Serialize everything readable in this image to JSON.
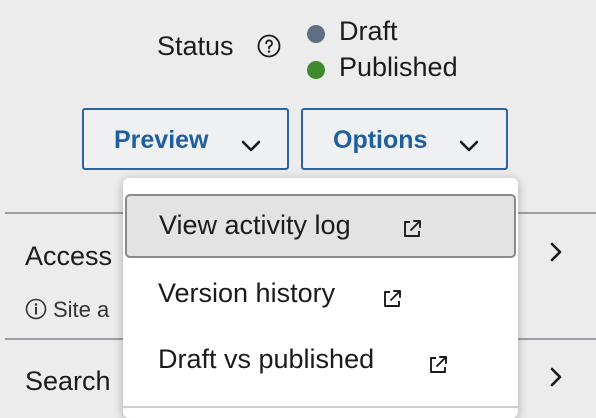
{
  "status": {
    "label": "Status",
    "help_icon": "question-circle-icon",
    "options": [
      {
        "label": "Draft",
        "color": "#5e6f82"
      },
      {
        "label": "Published",
        "color": "#3f8a2c"
      }
    ]
  },
  "buttons": {
    "preview_label": "Preview",
    "options_label": "Options",
    "accent_color": "#1f5f9e",
    "chevron_icon": "chevron-down-icon"
  },
  "sections": [
    {
      "label": "Access"
    },
    {
      "label": "Search"
    }
  ],
  "info": {
    "text": "Site a",
    "icon": "info-circle-icon"
  },
  "options_menu": {
    "items": [
      {
        "label": "View activity log",
        "icon": "external-link-icon",
        "highlighted": true
      },
      {
        "label": "Version history",
        "icon": "external-link-icon"
      },
      {
        "label": "Draft vs published",
        "icon": "external-link-icon"
      }
    ]
  }
}
